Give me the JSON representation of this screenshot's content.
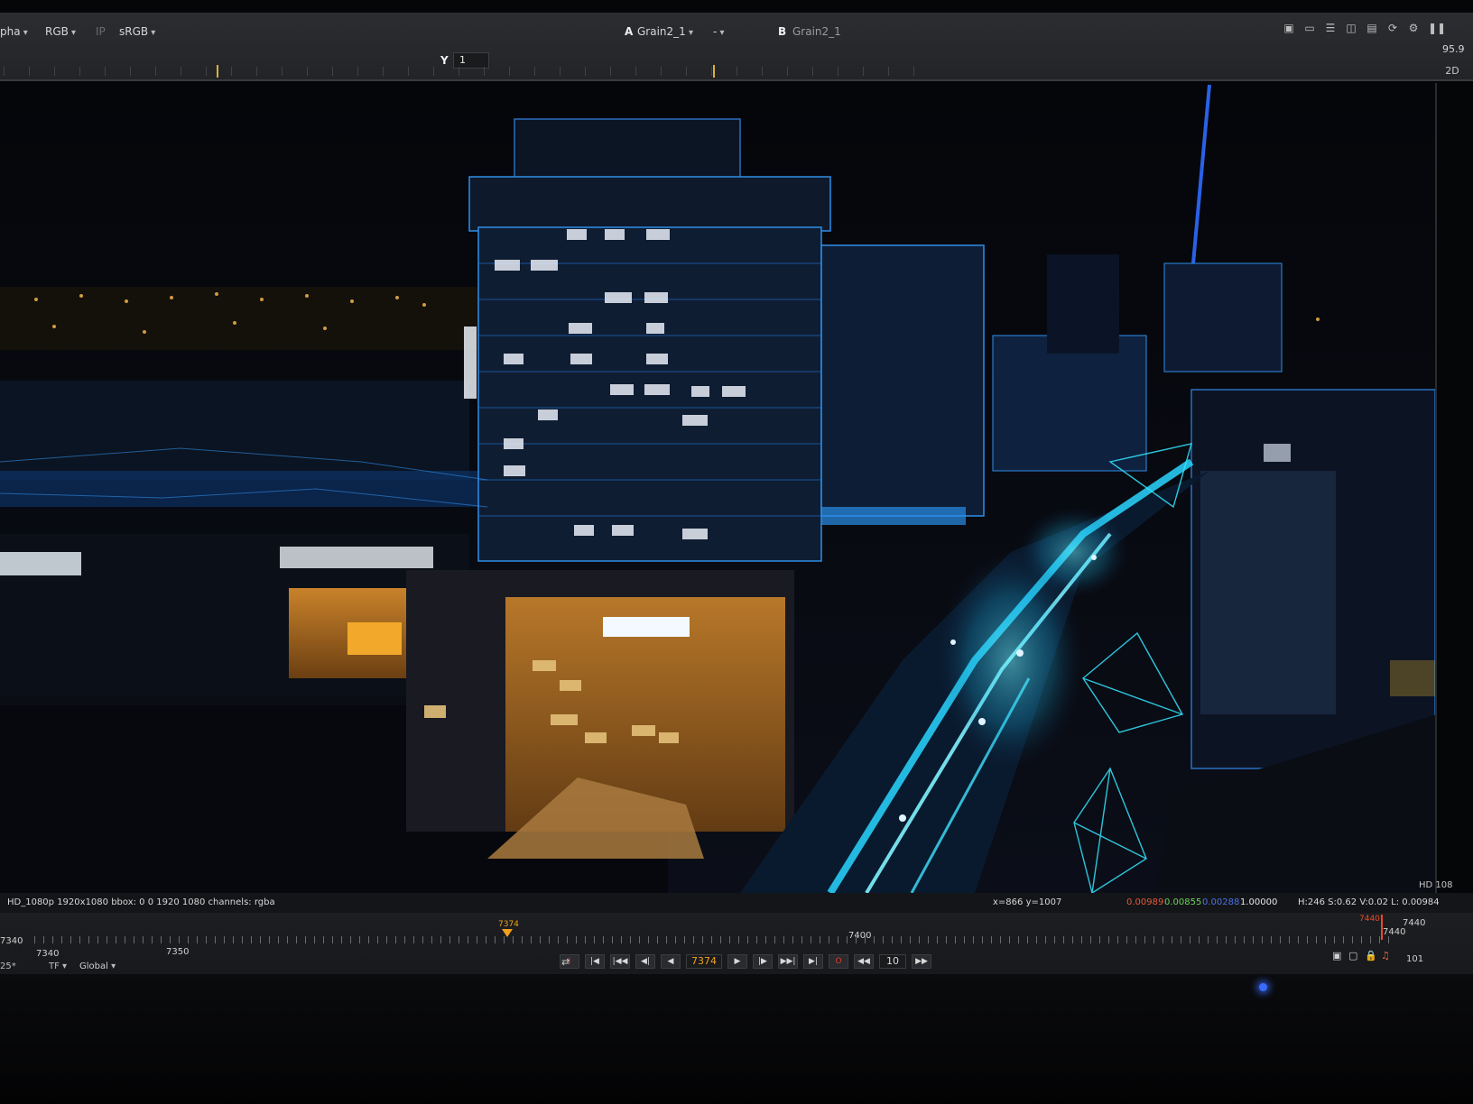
{
  "toolbar": {
    "channel_alpha": "pha",
    "channel_rgb": "RGB",
    "ip_label": "IP",
    "colorspace": "sRGB",
    "input_a_letter": "A",
    "input_a": "Grain2_1",
    "composite_op": "-",
    "input_b_letter": "B",
    "input_b": "Grain2_1",
    "y_label": "Y",
    "y_value": "1",
    "zoom": "95.9",
    "view_mode": "2D"
  },
  "icons": {
    "roi": "roi-icon",
    "proxy": "proxy-icon",
    "wipe": "wipe-icon",
    "overlay": "overlay-icon",
    "lut": "lut-icon",
    "refresh": "refresh-icon",
    "settings": "gear-icon",
    "pause": "pause-icon"
  },
  "infobar": {
    "format": "HD_1080p 1920x1080  bbox: 0 0 1920 1080 channels: rgba",
    "coords": "x=866 y=1007",
    "r": "0.00989",
    "g": "0.00855",
    "b": "0.00288",
    "a": "1.00000",
    "hsv": "H:246 S:0.62 V:0.02  L: 0.00984",
    "format_short": "HD 108"
  },
  "timeline": {
    "frame_start": "7340",
    "frame_start_small": "7340",
    "tick_7350": "7350",
    "tick_7400": "7400",
    "current_frame": "7374",
    "out_marker": "7440",
    "out_marker_small": "7440",
    "end_frame": "7440",
    "range_count": "101",
    "increment": "10",
    "fps": "25*",
    "tf_label": "TF",
    "scope": "Global"
  },
  "colors": {
    "accent_orange": "#f0a01e",
    "wire_cyan": "#2fe0ff",
    "night_sky": "#07080c",
    "red_channel": "#e35a3a",
    "green_channel": "#6bd35a",
    "blue_channel": "#4a72e6"
  }
}
